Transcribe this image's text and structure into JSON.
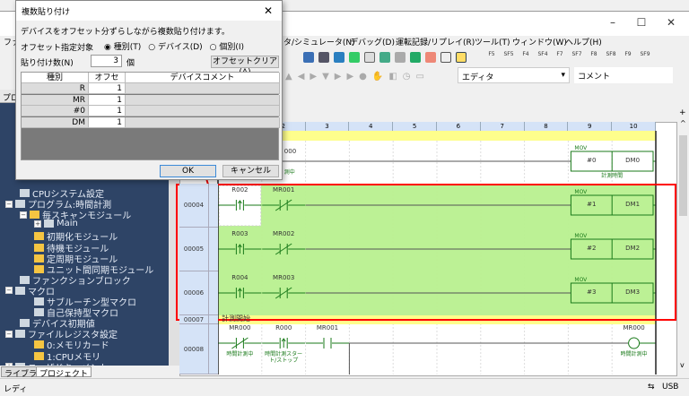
{
  "window": {
    "menu": [
      "タ/シミュレータ(N)",
      "デバッグ(D)",
      "運転記録/リプレイ(R)",
      "ツール(T)",
      "ウィンドウ(W)",
      "ヘルプ(H)"
    ],
    "menu_first_partial": "ファ",
    "fkeys": [
      "F5",
      "SF5",
      "F4",
      "SF4",
      "F7",
      "SF7",
      "F8",
      "SF8",
      "F9",
      "SF9"
    ],
    "editor_select": "エディタ",
    "comment_select": "コメント"
  },
  "project_panel": {
    "header": "プロ",
    "tree": [
      {
        "label": "CPUシステム設定",
        "icon": "cpu-icon",
        "indent": 1
      },
      {
        "label": "プログラム:時間計測",
        "icon": "program-icon",
        "indent": 0,
        "expander": "minus"
      },
      {
        "label": "毎スキャンモジュール",
        "icon": "folder-icon",
        "indent": 1,
        "expander": "minus"
      },
      {
        "label": "Main",
        "icon": "ladder-file-icon",
        "indent": 2,
        "expander": "plus"
      },
      {
        "label": "初期化モジュール",
        "icon": "folder-icon",
        "indent": 2
      },
      {
        "label": "待機モジュール",
        "icon": "folder-icon",
        "indent": 2
      },
      {
        "label": "定周期モジュール",
        "icon": "folder-icon",
        "indent": 2
      },
      {
        "label": "ユニット間同期モジュール",
        "icon": "folder-icon",
        "indent": 2
      },
      {
        "label": "ファンクションブロック",
        "icon": "function-block-icon",
        "indent": 1
      },
      {
        "label": "マクロ",
        "icon": "macro-icon",
        "indent": 0,
        "expander": "minus"
      },
      {
        "label": "サブルーチン型マクロ",
        "icon": "macro-item-icon",
        "indent": 2
      },
      {
        "label": "自己保持型マクロ",
        "icon": "macro-item-icon",
        "indent": 2
      },
      {
        "label": "デバイス初期値",
        "icon": "grid-icon",
        "indent": 1
      },
      {
        "label": "ファイルレジスタ設定",
        "icon": "file-register-icon",
        "indent": 0,
        "expander": "minus"
      },
      {
        "label": "0:メモリカード",
        "icon": "folder-icon",
        "indent": 2
      },
      {
        "label": "1:CPUメモリ",
        "icon": "folder-icon",
        "indent": 2
      },
      {
        "label": "ユーザドキュメント",
        "icon": "document-icon",
        "indent": 0,
        "expander": "plus"
      }
    ],
    "tabs": [
      "ライブラリ",
      "プロジェクト"
    ],
    "active_tab": 1
  },
  "status": {
    "text": "レディ",
    "connection": "USB"
  },
  "ladder": {
    "columns": [
      "2",
      "3",
      "4",
      "5",
      "6",
      "7",
      "8",
      "9",
      "10"
    ],
    "rungs": [
      {
        "num": "00004",
        "highlight": true,
        "elements": [
          {
            "type": "rising",
            "col": 1,
            "dev": "R002"
          },
          {
            "type": "nc",
            "col": 2,
            "dev": "MR001"
          }
        ],
        "mov": {
          "src": "#1",
          "dst": "DM1"
        }
      },
      {
        "num": "00005",
        "highlight": true,
        "elements": [
          {
            "type": "rising",
            "col": 1,
            "dev": "R003"
          },
          {
            "type": "nc",
            "col": 2,
            "dev": "MR002"
          }
        ],
        "mov": {
          "src": "#2",
          "dst": "DM2"
        }
      },
      {
        "num": "00006",
        "highlight": true,
        "elements": [
          {
            "type": "rising",
            "col": 1,
            "dev": "R004"
          },
          {
            "type": "nc",
            "col": 2,
            "dev": "MR003"
          }
        ],
        "mov": {
          "src": "#3",
          "dst": "DM3"
        }
      },
      {
        "num": "00007",
        "comment": "計測開始"
      },
      {
        "num": "00008",
        "elements": [
          {
            "type": "nc",
            "col": 1,
            "dev": "MR000",
            "comment": "時間計測中"
          },
          {
            "type": "rising",
            "col": 2,
            "dev": "R000",
            "comment": "時間計測スタート/ストップ"
          },
          {
            "type": "no",
            "col": 3,
            "dev": "MR001"
          }
        ],
        "coil": {
          "dev": "MR000",
          "comment": "時間計測中"
        }
      }
    ],
    "partial_rung": {
      "dev": "000",
      "comment": "測中",
      "mov": {
        "src": "#0",
        "dst": "DM0",
        "comment": "計測時間"
      }
    },
    "mov_label": "MOV",
    "colors": {
      "highlight": "#b8f08f",
      "comment_row": "#fefe8c",
      "selection_box": "#ff0000",
      "ladder_green": "#1a7a1a"
    }
  },
  "dialog": {
    "title": "複数貼り付け",
    "description": "デバイスをオフセット分ずらしながら複数貼り付けます。",
    "offset_target_label": "オフセット指定対象",
    "radios": [
      "種別(T)",
      "デバイス(D)",
      "個別(I)"
    ],
    "selected_radio": 0,
    "count_label": "貼り付け数(N)",
    "count_value": "3",
    "count_unit": "個",
    "clear_button": "オフセットクリア(A)",
    "table": {
      "headers": [
        "種別",
        "オフセット",
        "デバイスコメント"
      ],
      "rows": [
        {
          "type": "R",
          "offset": "1"
        },
        {
          "type": "MR",
          "offset": "1"
        },
        {
          "type": "#0",
          "offset": "1"
        },
        {
          "type": "DM",
          "offset": "1"
        }
      ]
    },
    "ok": "OK",
    "cancel": "キャンセル"
  }
}
